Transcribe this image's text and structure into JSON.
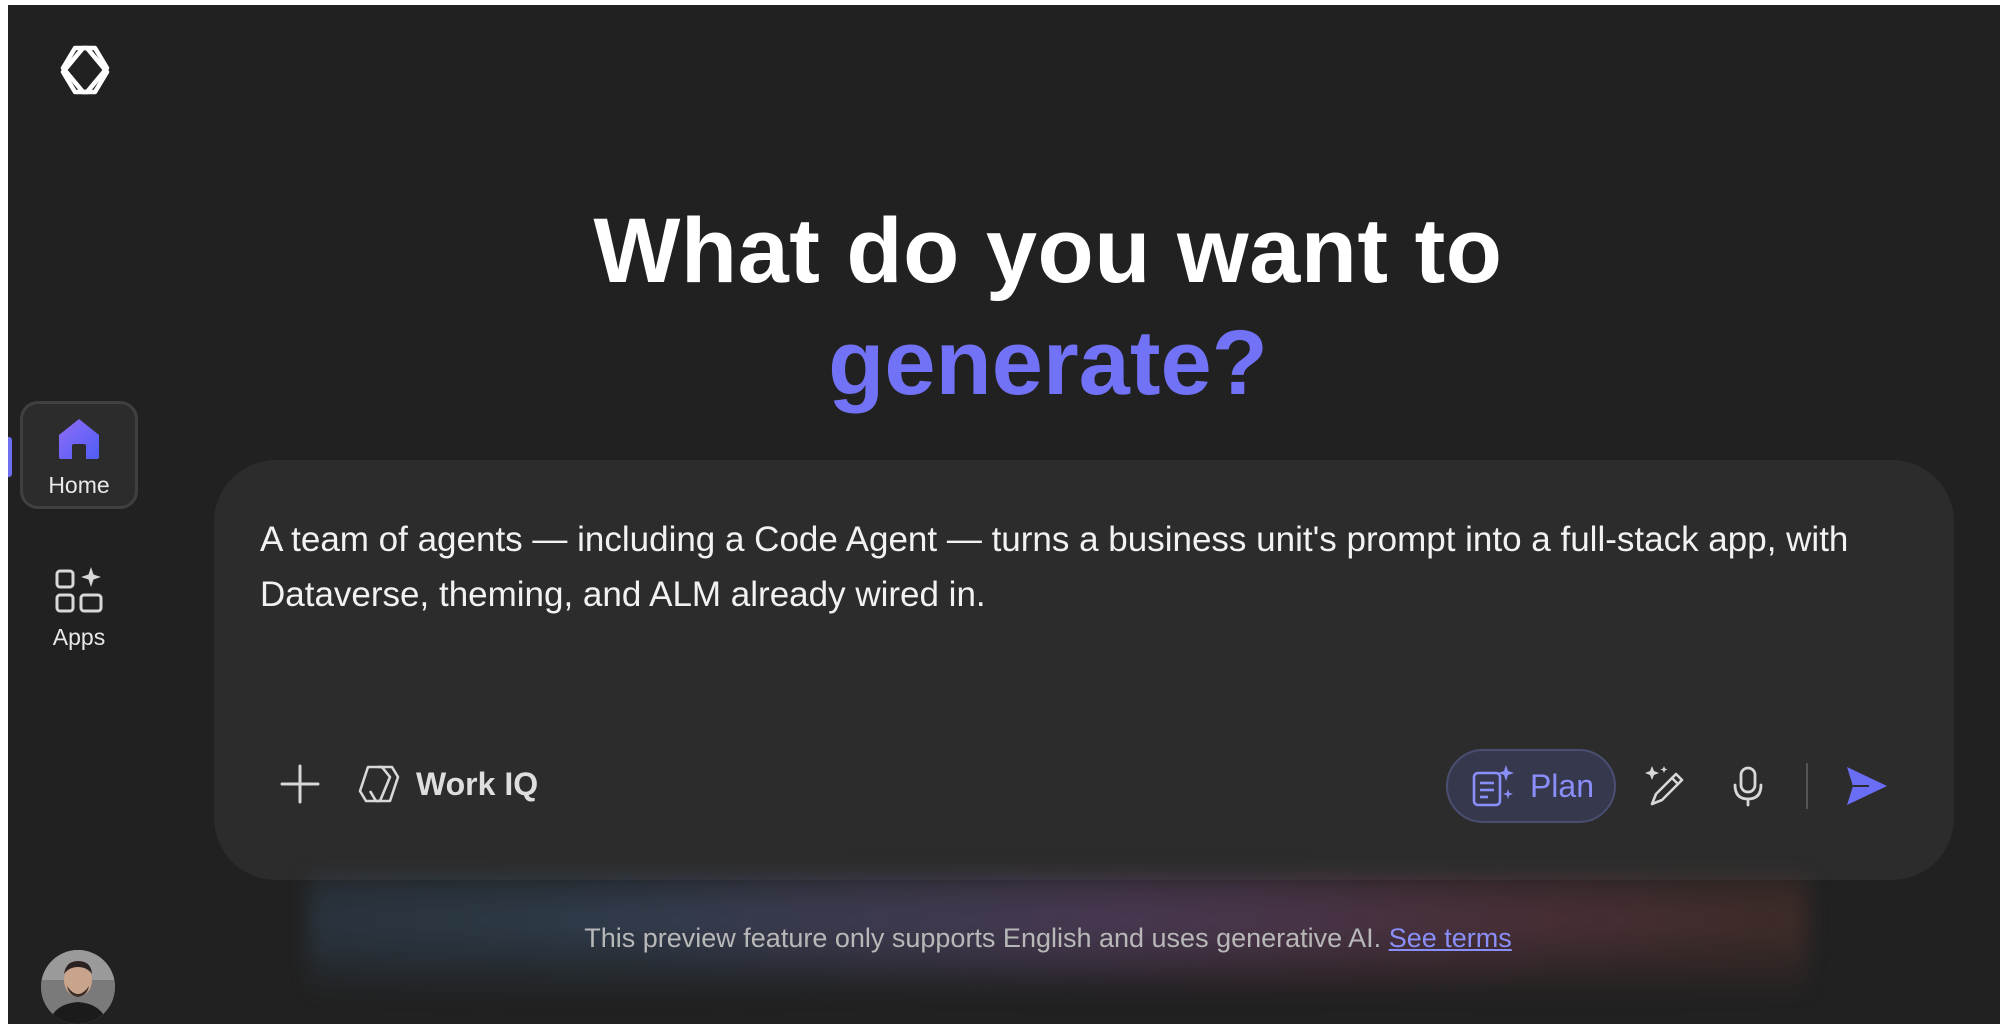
{
  "sidebar": {
    "items": [
      {
        "label": "Home",
        "icon": "home-icon",
        "active": true
      },
      {
        "label": "Apps",
        "icon": "apps-icon",
        "active": false
      }
    ]
  },
  "hero": {
    "line1": "What do you want to",
    "line2": "generate?"
  },
  "prompt": {
    "text": "A team of agents — including a Code Agent — turns a business unit's prompt into a full-stack app, with Dataverse, theming, and ALM already wired in."
  },
  "toolbar": {
    "workiq_label": "Work IQ",
    "plan_label": "Plan"
  },
  "footer": {
    "disclaimer": "This preview feature only supports English and uses generative AI.",
    "terms_link": "See terms"
  },
  "colors": {
    "background": "#212121",
    "card": "#2c2c2c",
    "accent": "#7272f6"
  }
}
